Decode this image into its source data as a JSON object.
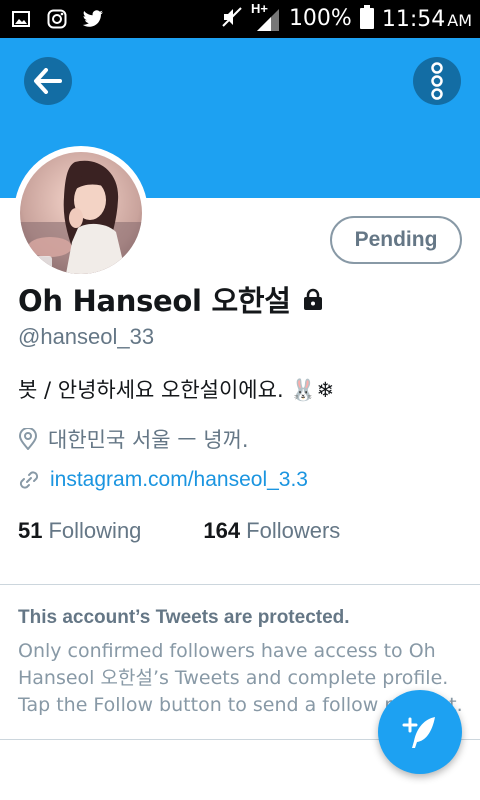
{
  "status_bar": {
    "network": "H+",
    "battery_percent": "100%",
    "time": "11:54",
    "ampm": "AM"
  },
  "header": {
    "back_icon": "arrow-left-icon",
    "more_icon": "vertical-dots-icon",
    "background_color": "#1da1f2"
  },
  "profile": {
    "follow_status_label": "Pending",
    "name": "Oh Hanseol 오한설",
    "locked_icon": "lock-icon",
    "handle": "@hanseol_33",
    "bio": "봇  /  안녕하세요 오한설이에요. 🐰❄",
    "location": "대한민국 서울 ㅡ 녕꺼.",
    "website": "instagram.com/hanseol_3.3",
    "following_count": "51",
    "following_label": "Following",
    "followers_count": "164",
    "followers_label": "Followers"
  },
  "protected_notice": {
    "title": "This account’s Tweets are protected.",
    "body": "Only confirmed followers have access to Oh Hanseol 오한설’s Tweets and complete profile. Tap the Follow button to send a follow request."
  },
  "fab": {
    "icon": "compose-tweet-icon"
  }
}
